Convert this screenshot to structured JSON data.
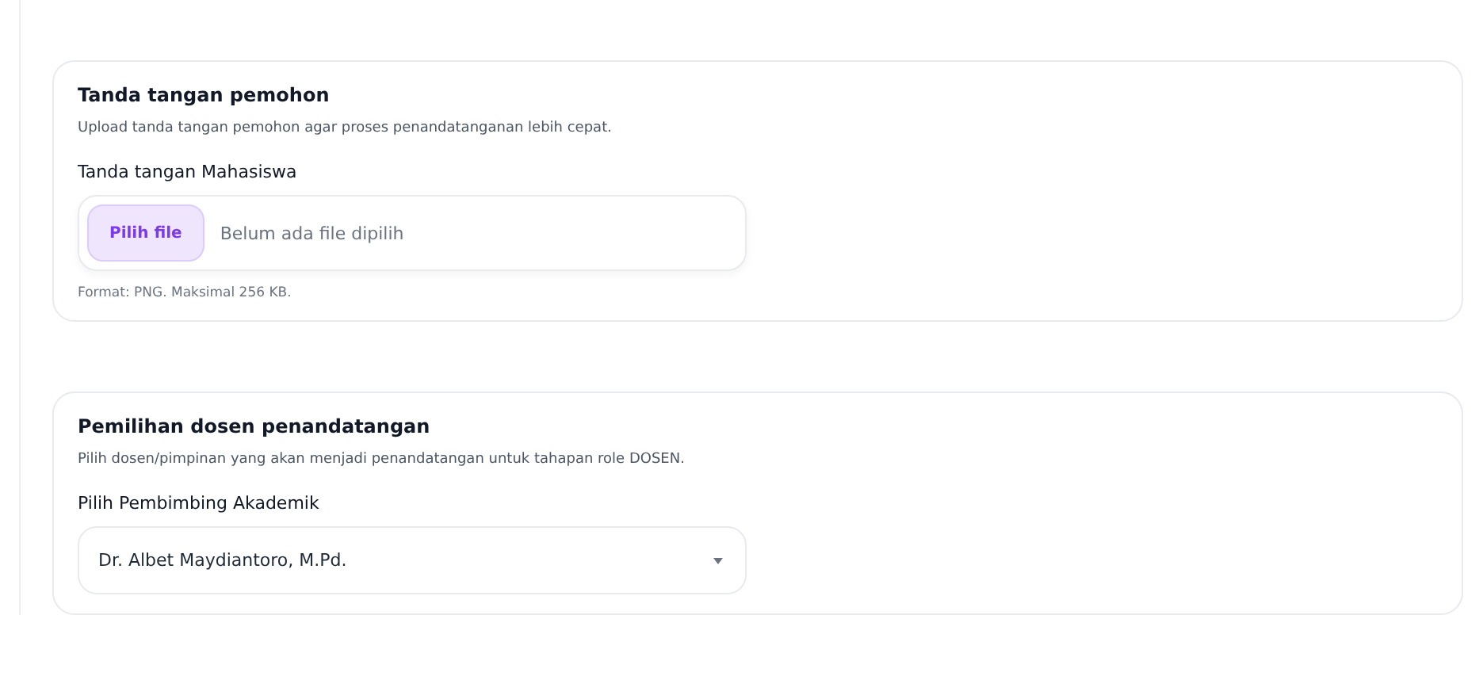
{
  "sections": [
    {
      "title": "Tanda tangan pemohon",
      "description": "Upload tanda tangan pemohon agar proses penandatanganan lebih cepat.",
      "field": {
        "kind": "file",
        "label": "Tanda tangan Mahasiswa",
        "button": "Pilih file",
        "value": "Belum ada file dipilih",
        "hint": "Format: PNG. Maksimal 256 KB."
      }
    },
    {
      "title": "Pemilihan dosen penandatangan",
      "description": "Pilih dosen/pimpinan yang akan menjadi penandatangan untuk tahapan role DOSEN.",
      "field": {
        "kind": "select",
        "label": "Pilih Pembimbing Akademik",
        "value": "Dr. Albet Maydiantoro, M.Pd."
      }
    }
  ]
}
